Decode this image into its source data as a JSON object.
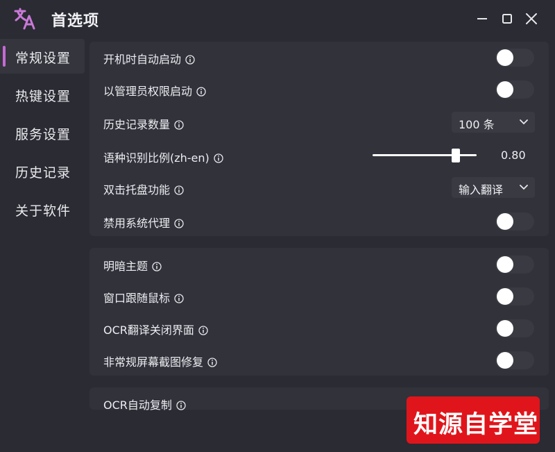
{
  "window": {
    "title": "首选项",
    "logo_icon": "translate-icon",
    "controls": [
      "minimize-icon",
      "maximize-icon",
      "close-icon"
    ]
  },
  "sidebar": {
    "items": [
      {
        "label": "常规设置",
        "active": true
      },
      {
        "label": "热键设置",
        "active": false
      },
      {
        "label": "服务设置",
        "active": false
      },
      {
        "label": "历史记录",
        "active": false
      },
      {
        "label": "关于软件",
        "active": false
      }
    ]
  },
  "group1": {
    "autostart_label": "开机时自动启动",
    "autostart_on": false,
    "admin_label": "以管理员权限启动",
    "admin_on": false,
    "history_count_label": "历史记录数量",
    "history_count_value": "100 条",
    "lang_ratio_label": "语种识别比例(zh-en)",
    "lang_ratio_value": "0.80",
    "lang_ratio_fraction": 0.8,
    "tray_dblclick_label": "双击托盘功能",
    "tray_dblclick_value": "输入翻译",
    "disable_proxy_label": "禁用系统代理",
    "disable_proxy_on": false
  },
  "group2": {
    "dark_theme_label": "明暗主题",
    "dark_theme_on": false,
    "follow_mouse_label": "窗口跟随鼠标",
    "follow_mouse_on": false,
    "ocr_close_label": "OCR翻译关闭界面",
    "ocr_close_on": false,
    "fix_screenshot_label": "非常规屏幕截图修复",
    "fix_screenshot_on": false
  },
  "group3": {
    "ocr_copy_label": "OCR自动复制"
  },
  "watermark": {
    "text": "知源自学堂"
  },
  "colors": {
    "background": "#2a2b33",
    "panel": "#31323a",
    "accent": "#c56ad4",
    "watermark": "#e0151b"
  }
}
